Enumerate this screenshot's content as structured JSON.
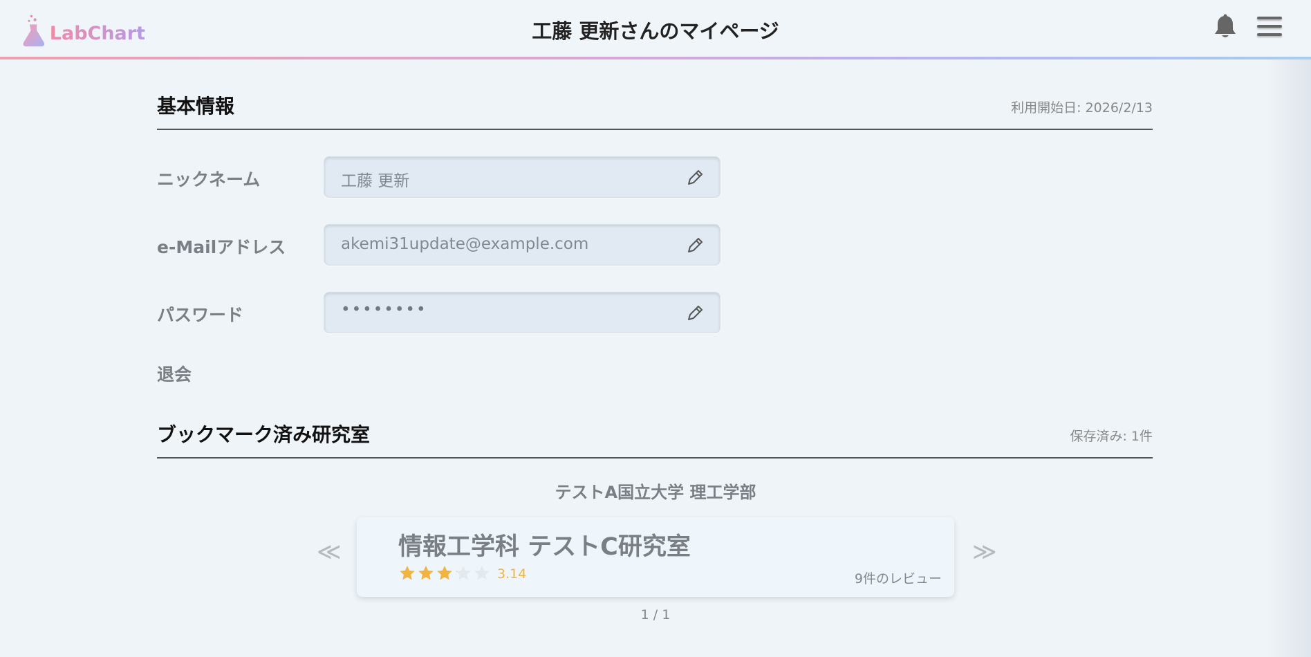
{
  "header": {
    "logo_text": "LabChart",
    "title": "工藤 更新さんのマイページ",
    "icons": [
      "flask-icon",
      "bell-icon",
      "hamburger-menu-icon"
    ],
    "gradient_colors": [
      "#ef9fae",
      "#d9a6d6",
      "#b9b3ee",
      "#a7cdee"
    ]
  },
  "basic_info": {
    "title": "基本情報",
    "start_date": "利用開始日: 2026/2/13",
    "fields": [
      {
        "label": "ニックネーム",
        "value": "工藤 更新"
      },
      {
        "label": "e-Mailアドレス",
        "value": "akemi31update@example.com"
      },
      {
        "label": "パスワード",
        "value": "••••••••"
      }
    ],
    "withdraw_label": "退会"
  },
  "bookmarks": {
    "title": "ブックマーク済み研究室",
    "saved_count": "保存済み: 1件",
    "university": "テストA国立大学 理工学部",
    "prev_arrow": "≪",
    "next_arrow": "≫",
    "card": {
      "lab_name": "情報工学科 テストC研究室",
      "rating": "3.14",
      "rating_value": 3.14,
      "max_rating": 5,
      "reviews": "9件のレビュー"
    },
    "pager": "1 / 1",
    "star_color": "#f2b441"
  }
}
